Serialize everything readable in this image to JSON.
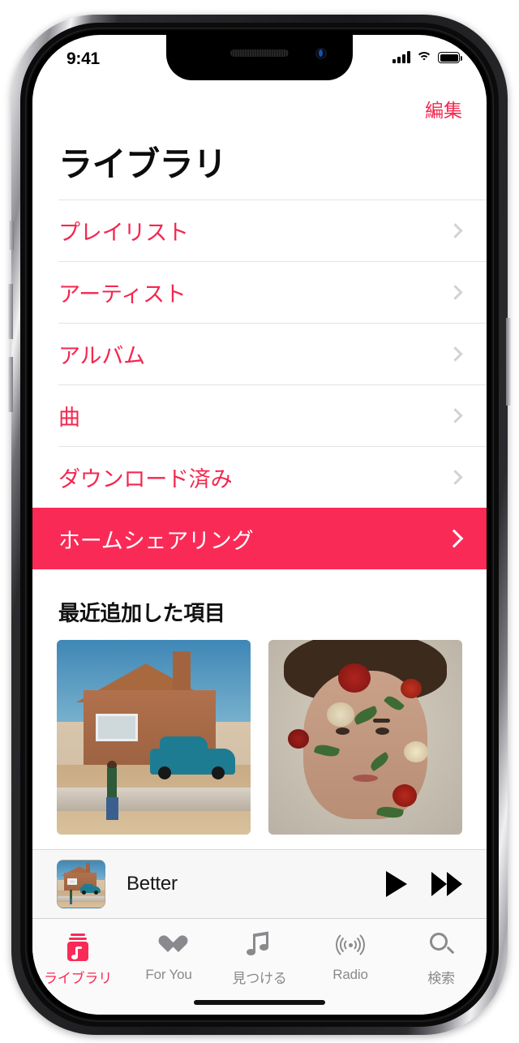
{
  "status_bar": {
    "time": "9:41",
    "signal_icon": "cellular-signal-icon",
    "wifi_icon": "wifi-icon",
    "battery_icon": "battery-full-icon"
  },
  "nav": {
    "edit_label": "編集"
  },
  "header": {
    "title": "ライブラリ"
  },
  "library_list": {
    "items": [
      {
        "label": "プレイリスト",
        "name": "playlists",
        "active": false
      },
      {
        "label": "アーティスト",
        "name": "artists",
        "active": false
      },
      {
        "label": "アルバム",
        "name": "albums",
        "active": false
      },
      {
        "label": "曲",
        "name": "songs",
        "active": false
      },
      {
        "label": "ダウンロード済み",
        "name": "downloaded",
        "active": false
      },
      {
        "label": "ホームシェアリング",
        "name": "home-sharing",
        "active": true
      }
    ]
  },
  "recently_added": {
    "title": "最近追加した項目",
    "albums": [
      {
        "artwork_name": "album-artwork-house-car"
      },
      {
        "artwork_name": "album-artwork-floral-portrait"
      }
    ]
  },
  "mini_player": {
    "track_title": "Better",
    "artwork_name": "now-playing-artwork",
    "play_icon": "play-icon",
    "forward_icon": "fast-forward-icon"
  },
  "tab_bar": {
    "tabs": [
      {
        "label": "ライブラリ",
        "icon": "library-icon",
        "name": "library",
        "active": true
      },
      {
        "label": "For You",
        "icon": "heart-icon",
        "name": "for-you",
        "active": false
      },
      {
        "label": "見つける",
        "icon": "music-note-icon",
        "name": "browse",
        "active": false
      },
      {
        "label": "Radio",
        "icon": "radio-waves-icon",
        "name": "radio",
        "active": false
      },
      {
        "label": "検索",
        "icon": "search-icon",
        "name": "search",
        "active": false
      }
    ]
  },
  "colors": {
    "accent_red": "#fa2a57",
    "link_red": "#f4274f",
    "inactive_gray": "#8a8a8e",
    "separator": "#e3e3e6"
  }
}
